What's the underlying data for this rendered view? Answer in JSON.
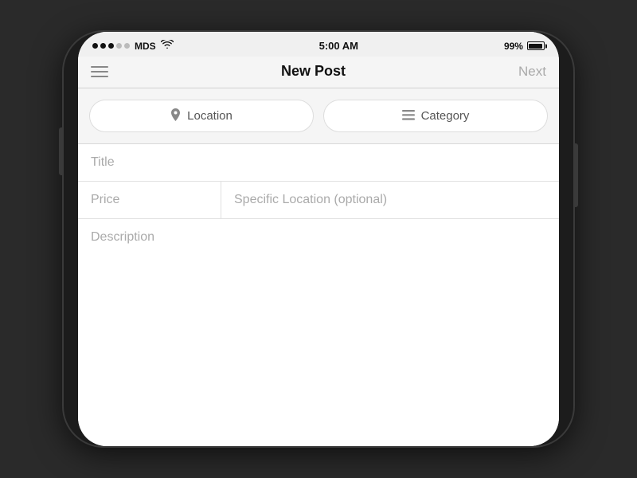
{
  "status": {
    "carrier": "MDS",
    "time": "5:00 AM",
    "battery_pct": "99%"
  },
  "nav": {
    "title": "New Post",
    "next_label": "Next"
  },
  "selectors": {
    "location_label": "Location",
    "category_label": "Category"
  },
  "form": {
    "title_placeholder": "Title",
    "price_placeholder": "Price",
    "specific_location_placeholder": "Specific Location (optional)",
    "description_placeholder": "Description"
  },
  "icons": {
    "hamburger": "≡",
    "location_pin": "📍",
    "category": "☰"
  }
}
